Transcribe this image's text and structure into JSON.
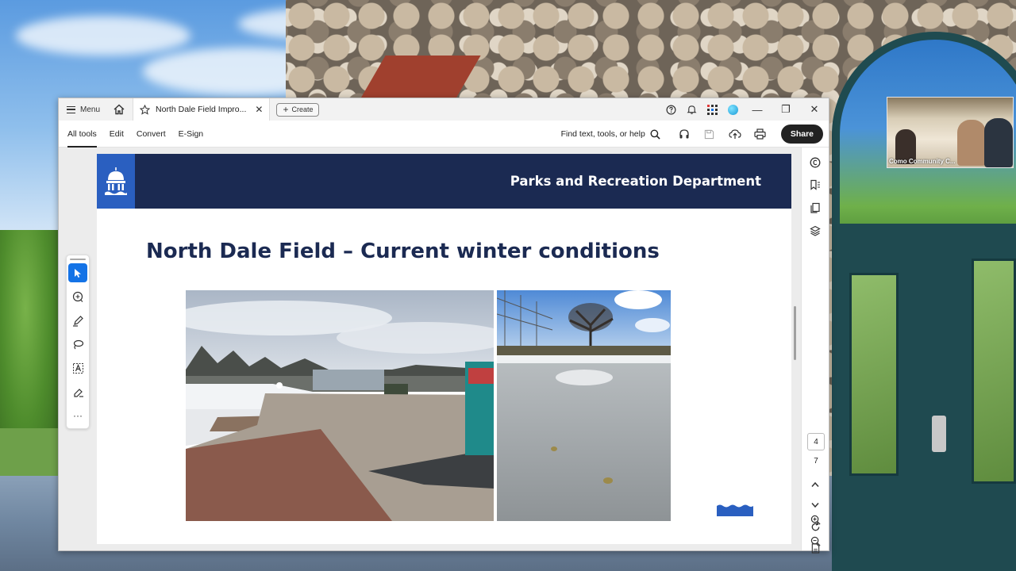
{
  "window": {
    "menu_label": "Menu",
    "tab_title": "North Dale Field Impro...",
    "create_label": "Create"
  },
  "toolbar": {
    "tabs": [
      "All tools",
      "Edit",
      "Convert",
      "E-Sign"
    ],
    "find_placeholder": "Find text, tools, or help",
    "share_label": "Share"
  },
  "slide": {
    "banner_title": "Parks and Recreation Department",
    "title": "North Dale Field – Current winter conditions"
  },
  "pager": {
    "current_page": "4",
    "total_pages": "7"
  },
  "video": {
    "participant_label": "Como Community C..."
  },
  "colors": {
    "banner": "#1b2a52",
    "logo_blue": "#2a5fc0",
    "accent": "#1473e6"
  }
}
